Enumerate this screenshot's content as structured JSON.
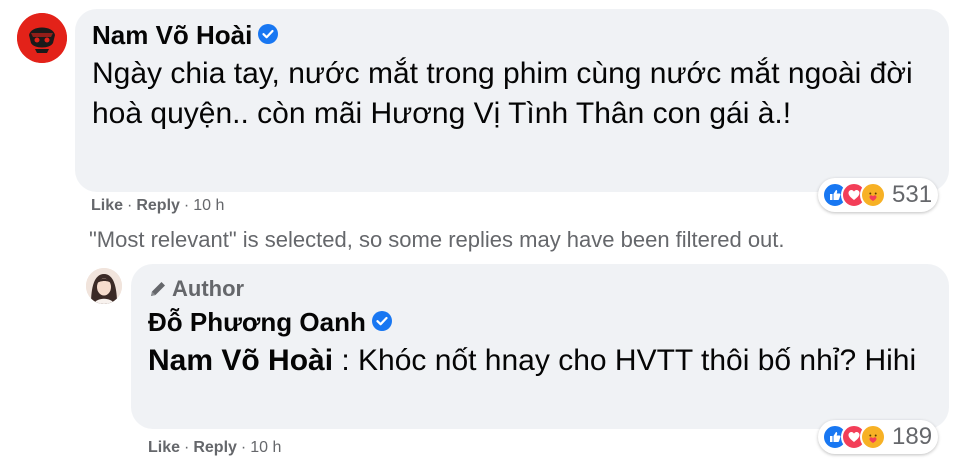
{
  "comments": [
    {
      "author": "Nam Võ Hoài",
      "verified": true,
      "text": "Ngày chia tay, nước mắt trong phim cùng nước mắt ngoài đời hoà quyện.. còn mãi Hương Vị Tình Thân con gái à.!",
      "actions": {
        "like": "Like",
        "reply": "Reply",
        "time": "10 h"
      },
      "reactions": {
        "icons": [
          "like-icon",
          "love-icon",
          "care-icon"
        ],
        "count": "531"
      }
    }
  ],
  "filter_note": "\"Most relevant\" is selected, so some replies may have been filtered out.",
  "reply": {
    "badge": "Author",
    "author": "Đỗ Phương Oanh",
    "verified": true,
    "mention": "Nam Võ Hoài",
    "text": " : Khóc nốt hnay cho HVTT thôi bố nhỉ? Hihi",
    "actions": {
      "like": "Like",
      "reply": "Reply",
      "time": "10 h"
    },
    "reactions": {
      "icons": [
        "like-icon",
        "love-icon",
        "care-icon"
      ],
      "count": "189"
    }
  },
  "colors": {
    "like": "#1877f2",
    "love": "#f33e58",
    "care": "#f7b125",
    "bubble": "#f0f2f5",
    "muted": "#65676b"
  }
}
